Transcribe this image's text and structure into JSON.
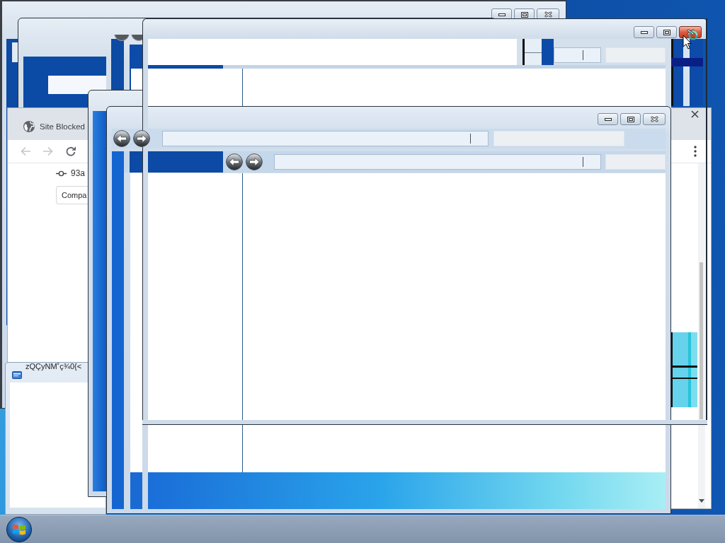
{
  "back_window": {
    "close_hovered": false
  },
  "browser": {
    "tab_title": "Site Blocked",
    "nav": [
      {
        "kind": "back",
        "disabled": true
      },
      {
        "kind": "forward",
        "disabled": true
      },
      {
        "kind": "reload",
        "disabled": false
      }
    ],
    "commit": "93a",
    "button": "Compa"
  },
  "small_window": {
    "title": "zQÇyNM˚ç¾0{<"
  },
  "explorer_window": {
    "close_hovered": false
  },
  "front_window": {
    "close_hovered": true
  }
}
